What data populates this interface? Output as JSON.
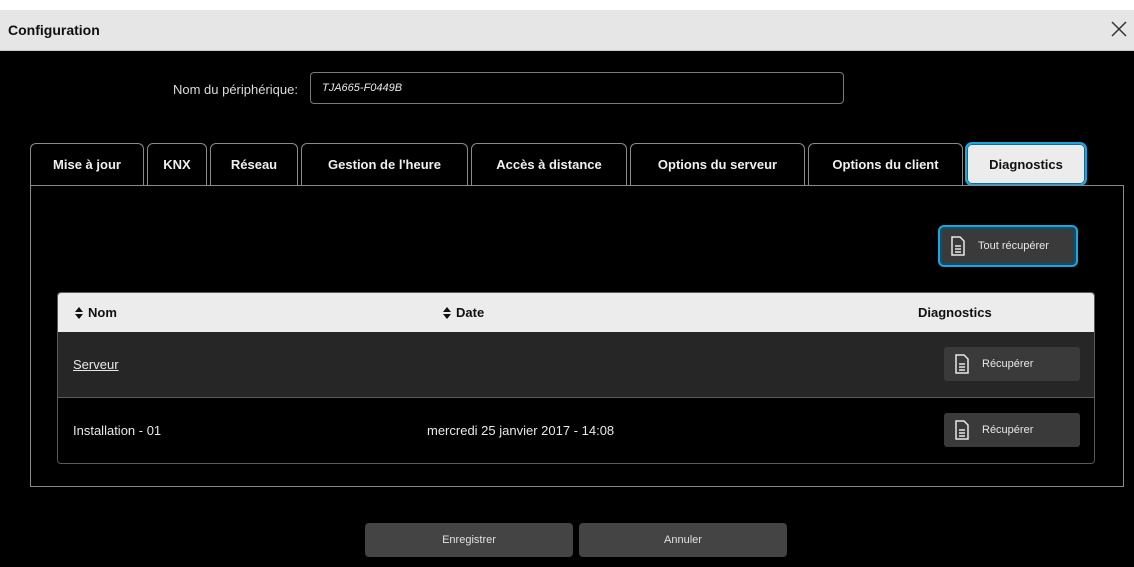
{
  "window": {
    "title": "Configuration"
  },
  "device": {
    "label": "Nom du périphérique:",
    "value": "TJA665-F0449B"
  },
  "tabs": [
    {
      "label": "Mise à jour"
    },
    {
      "label": "KNX"
    },
    {
      "label": "Réseau"
    },
    {
      "label": "Gestion de l'heure"
    },
    {
      "label": "Accès à distance"
    },
    {
      "label": "Options du serveur"
    },
    {
      "label": "Options du client"
    },
    {
      "label": "Diagnostics",
      "active": true
    }
  ],
  "actions": {
    "retrieve_all": "Tout récupérer"
  },
  "table": {
    "headers": {
      "name": "Nom",
      "date": "Date",
      "diagnostics": "Diagnostics"
    },
    "rows": [
      {
        "name": "Serveur",
        "date": "",
        "action": "Récupérer"
      },
      {
        "name": "Installation - 01",
        "date": "mercredi 25 janvier 2017 - 14:08",
        "action": "Récupérer"
      }
    ]
  },
  "footer": {
    "save": "Enregistrer",
    "cancel": "Annuler"
  },
  "colors": {
    "accent": "#1ba6de",
    "background": "#000000",
    "header_bg": "#ececec"
  },
  "icons": {
    "close": "close-icon",
    "sort": "sort-icon",
    "document": "document-icon"
  }
}
